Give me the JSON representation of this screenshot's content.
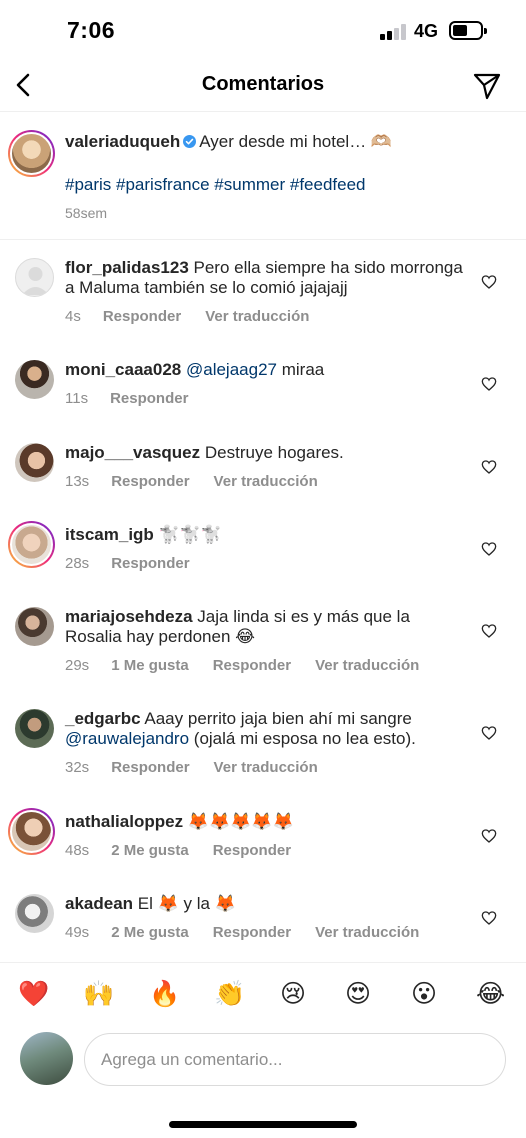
{
  "status": {
    "time": "7:06",
    "network": "4G"
  },
  "nav": {
    "title": "Comentarios"
  },
  "caption": {
    "username": "valeriaduqueh",
    "text": "Ayer desde mi hotel… 🫶🏼",
    "hashtags": "#paris #parisfrance #summer #feedfeed",
    "time": "58sem"
  },
  "comments": [
    {
      "username": "flor_palidas123",
      "text": "Pero ella siempre ha sido morronga a Maluma también se lo comió jajajajj",
      "time": "4s",
      "reply": "Responder",
      "translate": "Ver traducción"
    },
    {
      "username": "moni_caaa028",
      "mention": "@alejaag27",
      "text": "miraa",
      "time": "11s",
      "reply": "Responder"
    },
    {
      "username": "majo___vasquez",
      "text": "Destruye hogares.",
      "time": "13s",
      "reply": "Responder",
      "translate": "Ver traducción"
    },
    {
      "username": "itscam_igb",
      "text": "🐩🐩🐩",
      "time": "28s",
      "reply": "Responder"
    },
    {
      "username": "mariajosehdeza",
      "text": "Jaja linda si es y más que la Rosalia hay perdonen 😂",
      "time": "29s",
      "likes": "1 Me gusta",
      "reply": "Responder",
      "translate": "Ver traducción"
    },
    {
      "username": "_edgarbc",
      "text": "Aaay perrito jaja bien ahí mi sangre",
      "mention": "@rauwalejandro",
      "text2": "(ojalá mi esposa no lea esto).",
      "time": "32s",
      "reply": "Responder",
      "translate": "Ver traducción"
    },
    {
      "username": "nathalialoppez",
      "text": "🦊🦊🦊🦊🦊",
      "time": "48s",
      "likes": "2 Me gusta",
      "reply": "Responder"
    },
    {
      "username": "akadean",
      "text": "El 🦊 y la 🦊",
      "time": "49s",
      "likes": "2 Me gusta",
      "reply": "Responder",
      "translate": "Ver traducción"
    }
  ],
  "emojis": [
    "❤️",
    "🙌",
    "🔥",
    "👏",
    "😢",
    "😍",
    "😮",
    "😂"
  ],
  "input": {
    "placeholder": "Agrega un comentario..."
  },
  "colors": {
    "link": "#00376b",
    "muted": "#8e8e8e",
    "verified": "#3897f0",
    "heart_emoji": "#ed4956"
  }
}
